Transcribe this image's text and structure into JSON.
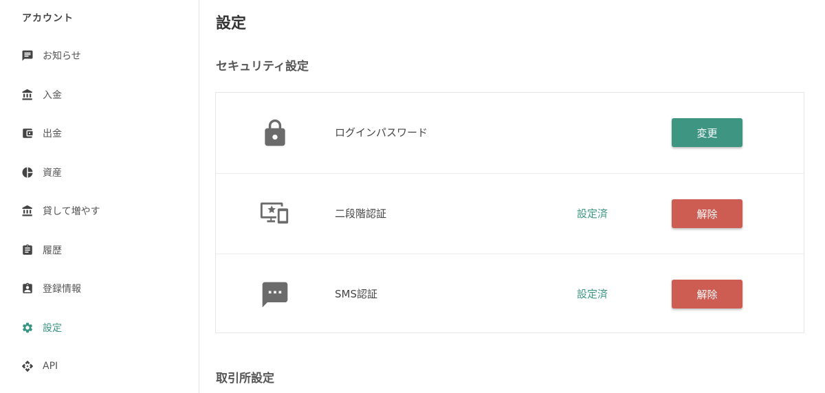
{
  "sidebar": {
    "title": "アカウント",
    "items": [
      {
        "label": "お知らせ",
        "icon": "message-icon"
      },
      {
        "label": "入金",
        "icon": "bank-icon"
      },
      {
        "label": "出金",
        "icon": "wallet-icon"
      },
      {
        "label": "資産",
        "icon": "pie-chart-icon"
      },
      {
        "label": "貸して増やす",
        "icon": "bank-icon"
      },
      {
        "label": "履歴",
        "icon": "clipboard-icon"
      },
      {
        "label": "登録情報",
        "icon": "id-badge-icon"
      },
      {
        "label": "設定",
        "icon": "gear-icon",
        "active": true
      },
      {
        "label": "API",
        "icon": "api-icon"
      }
    ]
  },
  "main": {
    "title": "設定",
    "security": {
      "title": "セキュリティ設定",
      "rows": [
        {
          "icon": "lock-icon",
          "label": "ログインパスワード",
          "status": "",
          "button": "変更"
        },
        {
          "icon": "devices-icon",
          "label": "二段階認証",
          "status": "設定済",
          "button": "解除"
        },
        {
          "icon": "sms-icon",
          "label": "SMS認証",
          "status": "設定済",
          "button": "解除"
        }
      ]
    },
    "exchange": {
      "title": "取引所設定"
    }
  },
  "colors": {
    "accent": "#3a9483",
    "button_green": "#3d9582",
    "button_red": "#cd5c52"
  }
}
